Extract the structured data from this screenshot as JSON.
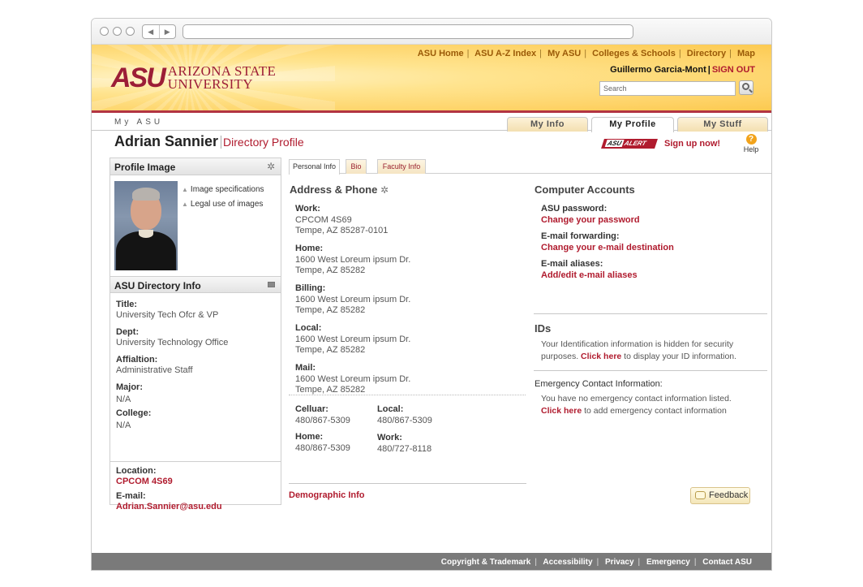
{
  "toplinks": [
    "ASU Home",
    "ASU A-Z Index",
    "My ASU",
    "Colleges & Schools",
    "Directory",
    "Map"
  ],
  "user": {
    "name": "Guillermo Garcia-Mont",
    "signout": "SIGN OUT"
  },
  "search": {
    "placeholder": "Search"
  },
  "logo": {
    "mark": "ASU",
    "line1": "ARIZONA STATE",
    "line2": "UNIVERSITY"
  },
  "tabbar": {
    "section": "My ASU",
    "tabs": [
      "My Info",
      "My Profile",
      "My Stuff"
    ],
    "active": "My Profile"
  },
  "header": {
    "name": "Adrian Sannier",
    "subtitle": "Directory Profile",
    "alert_label": "ALERT",
    "alert_prefix": "ASU",
    "signup": "Sign up now!",
    "help": "Help"
  },
  "profile_image": {
    "title": "Profile Image",
    "links": [
      "Image specifications",
      "Legal use of images"
    ]
  },
  "directory": {
    "title": "ASU Directory Info",
    "fields": [
      {
        "label": "Title:",
        "value": "University Tech Ofcr & VP"
      },
      {
        "label": "Dept:",
        "value": "University Technology Office"
      },
      {
        "label": "Affialtion:",
        "value": "Administrative Staff"
      },
      {
        "label": "Major:",
        "value": "N/A"
      },
      {
        "label": "College:",
        "value": "N/A"
      }
    ],
    "location_label": "Location:",
    "location": "CPCOM 4S69",
    "email_label": "E-mail:",
    "email": "Adrian.Sannier@asu.edu"
  },
  "subtabs": [
    "Personal Info",
    "Bio",
    "Faculty Info"
  ],
  "address": {
    "title": "Address & Phone",
    "blocks": [
      {
        "label": "Work:",
        "line1": "CPCOM 4S69",
        "line2": "Tempe, AZ 85287-0101"
      },
      {
        "label": "Home:",
        "line1": "1600 West Loreum ipsum Dr.",
        "line2": "Tempe, AZ 85282"
      },
      {
        "label": "Billing:",
        "line1": "1600 West Loreum ipsum Dr.",
        "line2": "Tempe, AZ 85282"
      },
      {
        "label": "Local:",
        "line1": "1600 West Loreum ipsum Dr.",
        "line2": "Tempe, AZ 85282"
      },
      {
        "label": "Mail:",
        "line1": "1600 West Loreum ipsum Dr.",
        "line2": "Tempe, AZ 85282"
      }
    ],
    "phones": [
      {
        "label": "Celluar:",
        "value": "480/867-5309"
      },
      {
        "label": "Local:",
        "value": "480/867-5309"
      },
      {
        "label": "Home:",
        "value": "480/867-5309"
      },
      {
        "label": "Work:",
        "value": "480/727-8118"
      }
    ],
    "demographic": "Demographic Info"
  },
  "accounts": {
    "title": "Computer Accounts",
    "items": [
      {
        "label": "ASU password:",
        "link": "Change your password"
      },
      {
        "label": "E-mail forwarding:",
        "link": "Change your e-mail destination"
      },
      {
        "label": "E-mail aliases:",
        "link": "Add/edit e-mail aliases"
      }
    ]
  },
  "ids": {
    "title": "IDs",
    "text1": "Your Identification information is hidden for security purposes.",
    "link": "Click here",
    "text2": "to display your ID information."
  },
  "emergency": {
    "title": "Emergency Contact Information:",
    "text1": "You have no emergency contact information listed.",
    "link": "Click here",
    "text2": "to add emergency contact information"
  },
  "feedback": "Feedback",
  "footer": [
    "Copyright & Trademark",
    "Accessibility",
    "Privacy",
    "Emergency",
    "Contact ASU"
  ]
}
